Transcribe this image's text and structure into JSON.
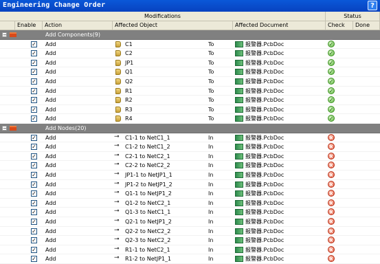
{
  "window": {
    "title": "Engineering Change Order",
    "help_label": "?"
  },
  "header": {
    "group_modifications": "Modifications",
    "group_status": "Status",
    "columns": [
      "Enable",
      "Action",
      "Affected Object",
      "Affected Document",
      "Check",
      "Done"
    ]
  },
  "groups": [
    {
      "label": "Add Components(9)",
      "start": 0
    },
    {
      "label": "Add Nodes(20)",
      "start": 9
    }
  ],
  "rows": [
    {
      "type": "group",
      "label": "Add Components(9)",
      "expander": "−"
    },
    {
      "type": "item",
      "enabled": true,
      "action": "Add",
      "object": "C1",
      "object_kind": "component",
      "direction": "To",
      "document": "报警器.PcbDoc",
      "check": "ok"
    },
    {
      "type": "item",
      "enabled": true,
      "action": "Add",
      "object": "C2",
      "object_kind": "component",
      "direction": "To",
      "document": "报警器.PcbDoc",
      "check": "ok"
    },
    {
      "type": "item",
      "enabled": true,
      "action": "Add",
      "object": "JP1",
      "object_kind": "component",
      "direction": "To",
      "document": "报警器.PcbDoc",
      "check": "ok"
    },
    {
      "type": "item",
      "enabled": true,
      "action": "Add",
      "object": "Q1",
      "object_kind": "component",
      "direction": "To",
      "document": "报警器.PcbDoc",
      "check": "ok"
    },
    {
      "type": "item",
      "enabled": true,
      "action": "Add",
      "object": "Q2",
      "object_kind": "component",
      "direction": "To",
      "document": "报警器.PcbDoc",
      "check": "ok"
    },
    {
      "type": "item",
      "enabled": true,
      "action": "Add",
      "object": "R1",
      "object_kind": "component",
      "direction": "To",
      "document": "报警器.PcbDoc",
      "check": "ok"
    },
    {
      "type": "item",
      "enabled": true,
      "action": "Add",
      "object": "R2",
      "object_kind": "component",
      "direction": "To",
      "document": "报警器.PcbDoc",
      "check": "ok"
    },
    {
      "type": "item",
      "enabled": true,
      "action": "Add",
      "object": "R3",
      "object_kind": "component",
      "direction": "To",
      "document": "报警器.PcbDoc",
      "check": "ok"
    },
    {
      "type": "item",
      "enabled": true,
      "action": "Add",
      "object": "R4",
      "object_kind": "component",
      "direction": "To",
      "document": "报警器.PcbDoc",
      "check": "ok"
    },
    {
      "type": "group",
      "label": "Add Nodes(20)",
      "expander": "−"
    },
    {
      "type": "item",
      "enabled": true,
      "action": "Add",
      "object": "C1-1 to NetC1_1",
      "object_kind": "node",
      "direction": "In",
      "document": "报警器.PcbDoc",
      "check": "error"
    },
    {
      "type": "item",
      "enabled": true,
      "action": "Add",
      "object": "C1-2 to NetC1_2",
      "object_kind": "node",
      "direction": "In",
      "document": "报警器.PcbDoc",
      "check": "error"
    },
    {
      "type": "item",
      "enabled": true,
      "action": "Add",
      "object": "C2-1 to NetC2_1",
      "object_kind": "node",
      "direction": "In",
      "document": "报警器.PcbDoc",
      "check": "error"
    },
    {
      "type": "item",
      "enabled": true,
      "action": "Add",
      "object": "C2-2 to NetC2_2",
      "object_kind": "node",
      "direction": "In",
      "document": "报警器.PcbDoc",
      "check": "error"
    },
    {
      "type": "item",
      "enabled": true,
      "action": "Add",
      "object": "JP1-1 to NetJP1_1",
      "object_kind": "node",
      "direction": "In",
      "document": "报警器.PcbDoc",
      "check": "error"
    },
    {
      "type": "item",
      "enabled": true,
      "action": "Add",
      "object": "JP1-2 to NetJP1_2",
      "object_kind": "node",
      "direction": "In",
      "document": "报警器.PcbDoc",
      "check": "error"
    },
    {
      "type": "item",
      "enabled": true,
      "action": "Add",
      "object": "Q1-1 to NetJP1_2",
      "object_kind": "node",
      "direction": "In",
      "document": "报警器.PcbDoc",
      "check": "error"
    },
    {
      "type": "item",
      "enabled": true,
      "action": "Add",
      "object": "Q1-2 to NetC2_1",
      "object_kind": "node",
      "direction": "In",
      "document": "报警器.PcbDoc",
      "check": "error"
    },
    {
      "type": "item",
      "enabled": true,
      "action": "Add",
      "object": "Q1-3 to NetC1_1",
      "object_kind": "node",
      "direction": "In",
      "document": "报警器.PcbDoc",
      "check": "error"
    },
    {
      "type": "item",
      "enabled": true,
      "action": "Add",
      "object": "Q2-1 to NetJP1_2",
      "object_kind": "node",
      "direction": "In",
      "document": "报警器.PcbDoc",
      "check": "error"
    },
    {
      "type": "item",
      "enabled": true,
      "action": "Add",
      "object": "Q2-2 to NetC2_2",
      "object_kind": "node",
      "direction": "In",
      "document": "报警器.PcbDoc",
      "check": "error"
    },
    {
      "type": "item",
      "enabled": true,
      "action": "Add",
      "object": "Q2-3 to NetC2_2",
      "object_kind": "node",
      "direction": "In",
      "document": "报警器.PcbDoc",
      "check": "error"
    },
    {
      "type": "item",
      "enabled": true,
      "action": "Add",
      "object": "R1-1 to NetC2_1",
      "object_kind": "node",
      "direction": "In",
      "document": "报警器.PcbDoc",
      "check": "error"
    },
    {
      "type": "item",
      "enabled": true,
      "action": "Add",
      "object": "R1-2 to NetJP1_1",
      "object_kind": "node",
      "direction": "In",
      "document": "报警器.PcbDoc",
      "check": "error"
    }
  ],
  "icons": {
    "group": "folder-icon",
    "component": "component-icon",
    "node": "pin-icon",
    "document": "pcb-document-icon",
    "ok": "check-ok-icon",
    "error": "check-error-icon"
  }
}
